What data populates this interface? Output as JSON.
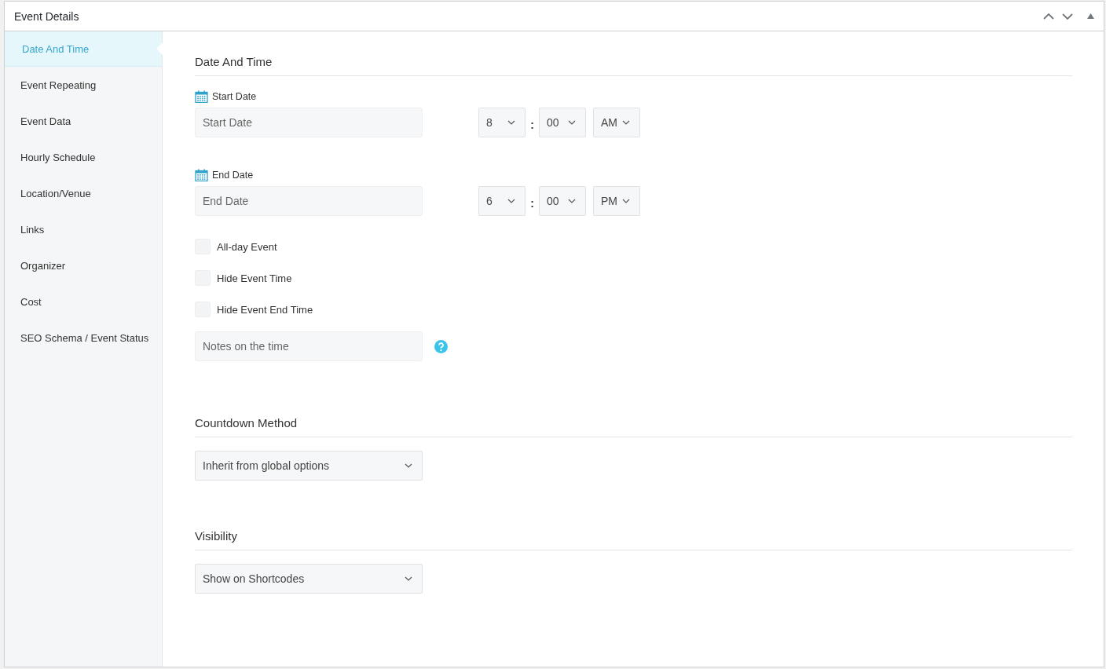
{
  "panel": {
    "title": "Event Details"
  },
  "sidebar": {
    "items": [
      {
        "label": "Date And Time",
        "selected": true
      },
      {
        "label": "Event Repeating",
        "selected": false
      },
      {
        "label": "Event Data",
        "selected": false
      },
      {
        "label": "Hourly Schedule",
        "selected": false
      },
      {
        "label": "Location/Venue",
        "selected": false
      },
      {
        "label": "Links",
        "selected": false
      },
      {
        "label": "Organizer",
        "selected": false
      },
      {
        "label": "Cost",
        "selected": false
      },
      {
        "label": "SEO Schema / Event Status",
        "selected": false
      }
    ]
  },
  "sections": [
    {
      "kind": "datetime",
      "heading": "Date And Time",
      "dates": [
        {
          "label": "Start Date",
          "placeholder": "Start Date",
          "hour": "8",
          "separator": ":",
          "minute": "00",
          "period": "AM"
        },
        {
          "label": "End Date",
          "placeholder": "End Date",
          "hour": "6",
          "separator": ":",
          "minute": "00",
          "period": "PM"
        }
      ],
      "checkboxes": [
        {
          "label": "All-day Event",
          "checked": false
        },
        {
          "label": "Hide Event Time",
          "checked": false
        },
        {
          "label": "Hide Event End Time",
          "checked": false
        }
      ],
      "notes": {
        "placeholder": "Notes on the time"
      }
    },
    {
      "kind": "select",
      "heading": "Countdown Method",
      "value": "Inherit from global options"
    },
    {
      "kind": "select",
      "heading": "Visibility",
      "value": "Show on Shortcodes"
    }
  ]
}
